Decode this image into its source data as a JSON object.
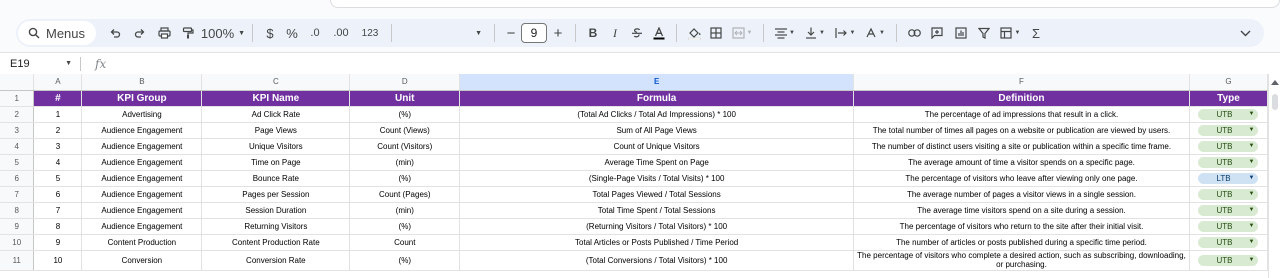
{
  "toolbar": {
    "menus_label": "Menus",
    "zoom": "100%",
    "currency": "$",
    "percent": "%",
    "dec_decrease": ".0",
    "dec_increase": ".00",
    "number_format": "123",
    "font_size": "9",
    "minus": "−",
    "plus": "+",
    "bold": "B",
    "italic": "I",
    "sum": "Σ"
  },
  "formula_bar": {
    "cell_ref": "E19",
    "fx": "fx",
    "value": ""
  },
  "columns": [
    "A",
    "B",
    "C",
    "D",
    "E",
    "F",
    "G"
  ],
  "selected_column": "E",
  "header_row": [
    "#",
    "KPI Group",
    "KPI Name",
    "Unit",
    "Formula",
    "Definition",
    "Type"
  ],
  "rows": [
    {
      "n": "2",
      "id": "1",
      "group": "Advertising",
      "name": "Ad Click Rate",
      "unit": "(%)",
      "formula": "(Total Ad Clicks / Total Ad Impressions) * 100",
      "definition": "The percentage of ad impressions that result in a click.",
      "type": "UTB"
    },
    {
      "n": "3",
      "id": "2",
      "group": "Audience Engagement",
      "name": "Page Views",
      "unit": "Count (Views)",
      "formula": "Sum of All Page Views",
      "definition": "The total number of times all pages on a website or publication are viewed by users.",
      "type": "UTB"
    },
    {
      "n": "4",
      "id": "3",
      "group": "Audience Engagement",
      "name": "Unique Visitors",
      "unit": "Count (Visitors)",
      "formula": "Count of Unique Visitors",
      "definition": "The number of distinct users visiting a site or publication within a specific time frame.",
      "type": "UTB"
    },
    {
      "n": "5",
      "id": "4",
      "group": "Audience Engagement",
      "name": "Time on Page",
      "unit": "(min)",
      "formula": "Average Time Spent on Page",
      "definition": "The average amount of time a visitor spends on a specific page.",
      "type": "UTB"
    },
    {
      "n": "6",
      "id": "5",
      "group": "Audience Engagement",
      "name": "Bounce Rate",
      "unit": "(%)",
      "formula": "(Single-Page Visits / Total Visits) * 100",
      "definition": "The percentage of visitors who leave after viewing only one page.",
      "type": "LTB"
    },
    {
      "n": "7",
      "id": "6",
      "group": "Audience Engagement",
      "name": "Pages per Session",
      "unit": "Count (Pages)",
      "formula": "Total Pages Viewed / Total Sessions",
      "definition": "The average number of pages a visitor views in a single session.",
      "type": "UTB"
    },
    {
      "n": "8",
      "id": "7",
      "group": "Audience Engagement",
      "name": "Session Duration",
      "unit": "(min)",
      "formula": "Total Time Spent / Total Sessions",
      "definition": "The average time visitors spend on a site during a session.",
      "type": "UTB"
    },
    {
      "n": "9",
      "id": "8",
      "group": "Audience Engagement",
      "name": "Returning Visitors",
      "unit": "(%)",
      "formula": "(Returning Visitors / Total Visitors) * 100",
      "definition": "The percentage of visitors who return to the site after their initial visit.",
      "type": "UTB"
    },
    {
      "n": "10",
      "id": "9",
      "group": "Content Production",
      "name": "Content Production Rate",
      "unit": "Count",
      "formula": "Total Articles or Posts Published / Time Period",
      "definition": "The number of articles or posts published during a specific time period.",
      "type": "UTB"
    },
    {
      "n": "11",
      "id": "10",
      "group": "Conversion",
      "name": "Conversion Rate",
      "unit": "(%)",
      "formula": "(Total Conversions / Total Visitors) * 100",
      "definition": "The percentage of visitors who complete a desired action, such as subscribing, downloading, or purchasing.",
      "type": "UTB"
    }
  ],
  "header_row_number": "1",
  "colors": {
    "header_fill": "#7030a0",
    "utb_chip": "#d9ead3",
    "ltb_chip": "#cfe2f3",
    "selected_col": "#d3e3fd"
  }
}
